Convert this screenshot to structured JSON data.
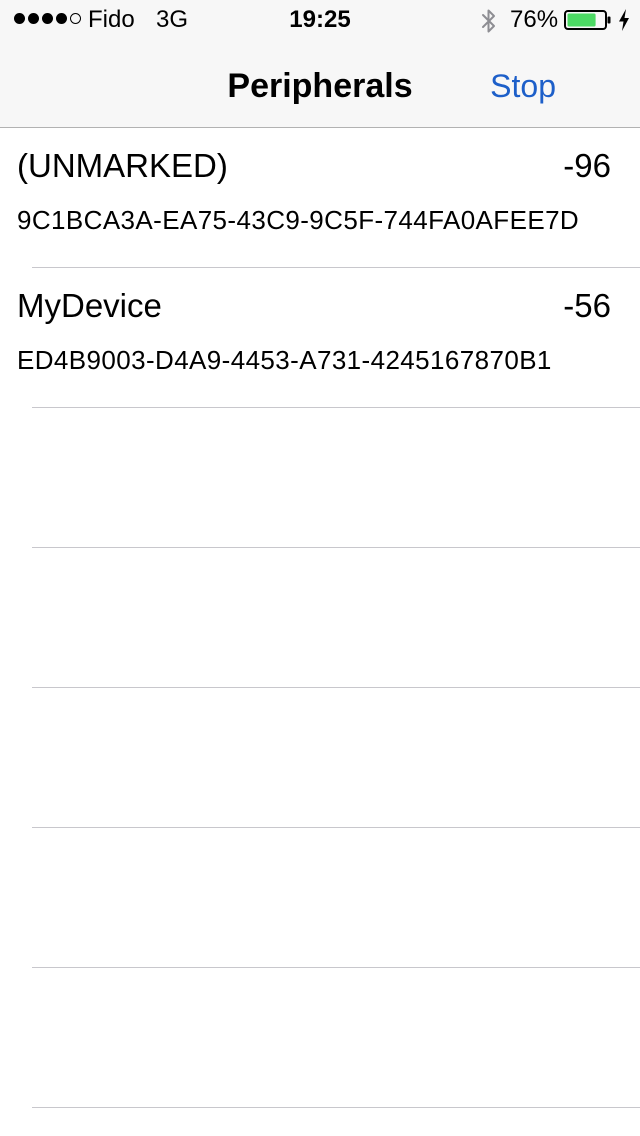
{
  "status_bar": {
    "signal_bars_filled": 4,
    "signal_bars_total": 5,
    "carrier": "Fido",
    "network": "3G",
    "time": "19:25",
    "bluetooth_icon": "bluetooth-icon",
    "battery_percent": "76%",
    "battery_level": 0.76,
    "battery_color": "#4cd964",
    "charging_icon": "lightning-bolt-icon"
  },
  "nav_bar": {
    "title": "Peripherals",
    "stop_label": "Stop",
    "accent_color": "#1d5fc9"
  },
  "peripherals": [
    {
      "name": "(UNMARKED)",
      "rssi": "-96",
      "uuid": "9C1BCA3A-EA75-43C9-9C5F-744FA0AFEE7D"
    },
    {
      "name": "MyDevice",
      "rssi": "-56",
      "uuid": "ED4B9003-D4A9-4453-A731-4245167870B1"
    }
  ]
}
